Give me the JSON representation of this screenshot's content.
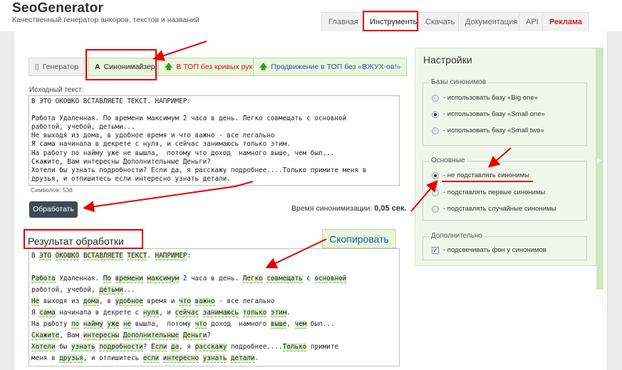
{
  "header": {
    "logo": "SeoGenerator",
    "tagline": "Качественный генератор анкоров, текстов и названий",
    "nav": [
      "Главная",
      "Инструменты",
      "Скачать",
      "Документация",
      "API",
      "Реклама"
    ]
  },
  "tabs": {
    "generator": "Генератор",
    "synonymizer": "Синонимайзер",
    "top_hands": "В ТОП без кривых рук",
    "top_wow": "Продвижение в ТОП без «ВЖУХ-ов!»"
  },
  "source": {
    "label": "Исходный текст:",
    "text": "В ЭТО ОКОШКО ВСТАВЛЯЕТЕ ТЕКСТ. НАПРИМЕР:\n\nРабота Удаленная. По времени максимум 2 часа в день. Легко совмещать с основной\nработой, учебой, детьми...\nНе выходя из дома, в удобное время и что важно - все легально\nЯ сама начинала в декрете с нуля, и сейчас занимаюсь только этим.\nНа работу по найму уже не вышла,  потому что доход  намного выше, чем был...\nСкажите, Вам интересны Дополнительные Деньги?\nХотели бы узнать подробности? Если да, я расскажу подробнее....Только примите меня в\nдрузья, и отпишитесь если интересно узнать детали.",
    "char_count": "Символов: 538"
  },
  "process_button": "Обработать",
  "timing": {
    "label": "Время синонимизации:",
    "value": "0,05 сек."
  },
  "result": {
    "title": "Результат обработки",
    "copy": "Скопировать",
    "lines": [
      "В <h>ЭТО</h> <h>ОКОШКО</h> <h>ВСТАВЛЯЕТЕ</h> <h>ТЕКСТ</h>. <h>НАПРИМЕР</h>:",
      "",
      "<h>Работа</h> Удаленная. <h>По</h> <h>времени</h> <h>максимум</h> 2 часа в день. <h>Легко</h> <h>совмещать</h> с <h>основной</h>",
      "работой, учебой, <h>детьми</h>...",
      "<h>Не</h> выходя из <h>дома</h>, в <h>удобное</h> время и <h>что</h> <h>важно</h> - все легально",
      "Я <h>сама</h> начинала в декрете с <h>нуля</h>, и <h>сейчас</h> <h>занимаюсь</h> <h>только</h> <h>этим</h>.",
      "На работу <h>по</h> <h>найму</h> <h>уже</h> <h>не</h> вышла,  потому <h>что</h> доход  намного <h>выше</h>, <h>чем</h> был...",
      "<h>Скажите</h>, Вам <h>интересны</h> <h>Дополнительные</h> <h>Деньги</h>?",
      "<h>Хотели</h> бы <h>узнать</h> <h>подробности</h>? <h>Если</h> <h>да</h>, я <h>расскажу</h> подробнее....<h>Только</h> примите",
      "меня в <h>друзья</h>, и отпишитесь <h>если</h> <h>интересно</h> <h>узнать</h> <h>детали</h>."
    ]
  },
  "settings": {
    "title": "Настройки",
    "bases": {
      "label": "Базы синонимов",
      "options": [
        "- использовать базу «Big one»",
        "- использовать базу «Small one»",
        "- использовать базу «Small two»"
      ],
      "selected": 1
    },
    "main": {
      "label": "Основные",
      "options": [
        "- не подставлять синонимы",
        "- подставлять первые синонимы",
        "- подставлять случайные синонимы"
      ],
      "selected": 0
    },
    "extra": {
      "label": "Дополнительно",
      "options": [
        "- подсвечивать фон у синонимов"
      ],
      "checked": true
    }
  },
  "colors": {
    "accent_green": "#eaf5dd",
    "highlight": "#dff0d0",
    "annotation_red": "#e60000",
    "ad_red": "#cc1f1f",
    "button_dark": "#3e4a58"
  }
}
